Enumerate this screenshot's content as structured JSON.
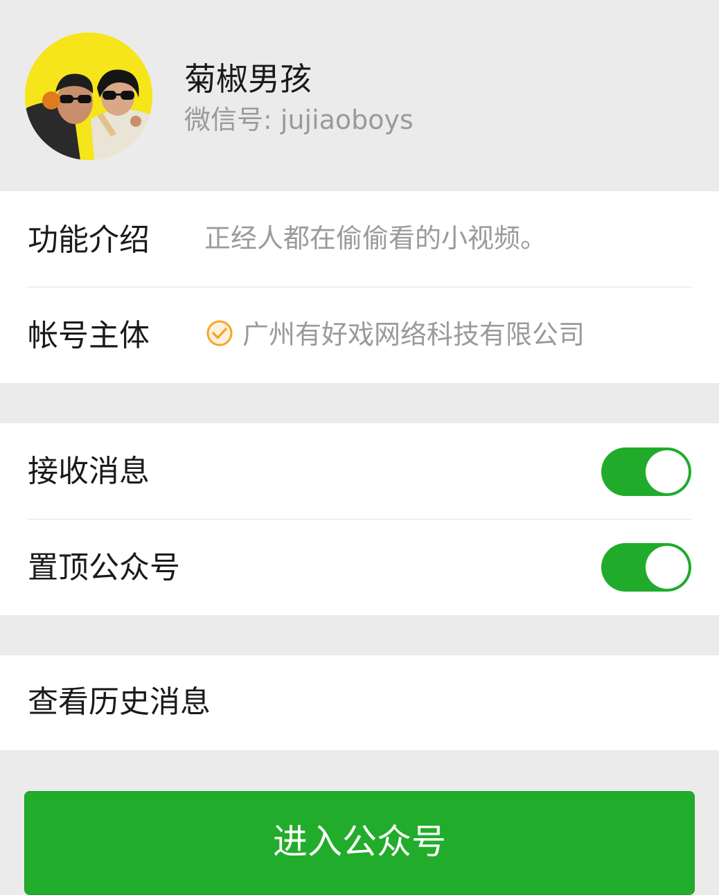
{
  "account": {
    "name": "菊椒男孩",
    "wechat_id": "微信号: jujiaoboys"
  },
  "info": {
    "intro_label": "功能介绍",
    "intro_value": "正经人都在偷偷看的小视频。",
    "entity_label": "帐号主体",
    "entity_value": "广州有好戏网络科技有限公司",
    "verified_icon": "verified-check-icon"
  },
  "settings": {
    "receive_messages_label": "接收消息",
    "receive_messages_on": true,
    "pin_account_label": "置顶公众号",
    "pin_account_on": true
  },
  "history": {
    "label": "查看历史消息"
  },
  "action": {
    "enter_label": "进入公众号"
  },
  "colors": {
    "accent_green": "#22ac2b",
    "background": "#ebebeb",
    "avatar_yellow": "#f6e51a",
    "verified_orange": "#f5a623"
  }
}
